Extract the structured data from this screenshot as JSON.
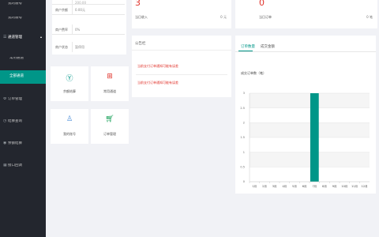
{
  "sidebar": {
    "items": [
      {
        "label": "我的账号",
        "top": 0
      },
      {
        "label": "我的账号",
        "top": 1
      }
    ],
    "top_item_1": "我的账号",
    "top_item_2": "我的账号",
    "group_label": "通道管理",
    "sub_items": [
      "常用通道",
      "全部通道"
    ],
    "menu": [
      "订单管理",
      "结算查询",
      "余额结算",
      "接口回调"
    ]
  },
  "account_info": {
    "rows": [
      {
        "key": "提现余额",
        "value": "0.00元"
      },
      {
        "key": "商户余额",
        "value": "0.00元"
      },
      {
        "key": "商户费率",
        "value": "0%"
      },
      {
        "key": "商户状态",
        "value": "暂停用"
      }
    ],
    "top_partial": "200.00"
  },
  "tiles": [
    {
      "label": "余额结算",
      "icon": "yen-circle-icon",
      "color": "#009688"
    },
    {
      "label": "常用通道",
      "icon": "qr-grid-icon",
      "color": "#e0322a"
    },
    {
      "label": "我的账号",
      "icon": "user-outline-icon",
      "color": "#4e8fd9"
    },
    {
      "label": "订单管理",
      "icon": "cart-icon",
      "color": "#1aa15a"
    }
  ],
  "stats": [
    {
      "number": "3",
      "label": "当日收入",
      "unit": "0 元"
    },
    {
      "number": "0",
      "label": "当日订单",
      "unit": "0 笔"
    }
  ],
  "announcement": {
    "title": "公告栏",
    "items": [
      "当前支付订单通知可能有误差",
      "当前支付订单通知可能有误差"
    ]
  },
  "chart_panel": {
    "tabs": [
      "订单数量",
      "成交金额"
    ],
    "chart_title": "成交订单数（笔）"
  },
  "chart_data": {
    "type": "bar",
    "categories": [
      "1月",
      "2月",
      "3月",
      "4月",
      "5月",
      "6月",
      "7月",
      "8月",
      "9月",
      "10月",
      "11月",
      "12月"
    ],
    "values": [
      0,
      0,
      0,
      0,
      0,
      0,
      3,
      0,
      0,
      0,
      0,
      0
    ],
    "ylim": [
      0,
      3
    ],
    "yticks": [
      "0",
      "0.5",
      "1",
      "1.5",
      "2",
      "2.5",
      "3"
    ],
    "bar_color": "#009688",
    "grid": true
  }
}
